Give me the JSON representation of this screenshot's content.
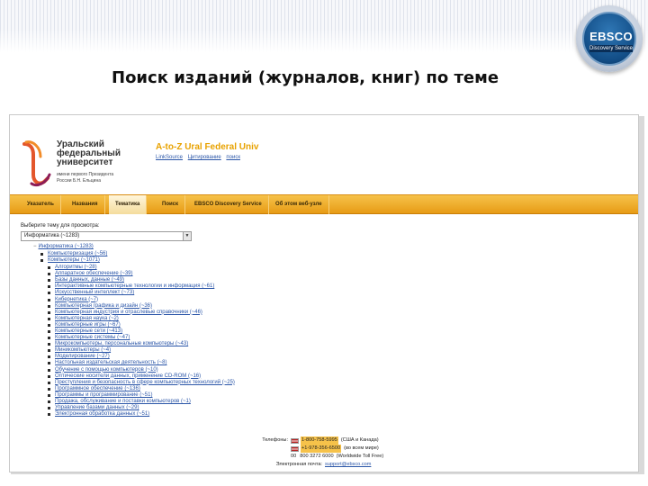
{
  "slide": {
    "title": "Поиск изданий (журналов, книг) по теме",
    "badge": {
      "brand": "EBSCO",
      "tagline": "Discovery Service"
    }
  },
  "site": {
    "university": [
      "Уральский",
      "федеральный",
      "университет"
    ],
    "university_sub": [
      "имени первого Президента",
      "России Б.Н. Ельцина"
    ],
    "az_title": "A-to-Z Ural Federal Univ",
    "az_links": [
      "LinkSource",
      "Цитирование",
      "поиск"
    ]
  },
  "nav": {
    "tabs": [
      "Указатель",
      "Названия",
      "Тематика",
      "Поиск",
      "EBSCO Discovery Service",
      "Об этом веб-узле"
    ],
    "active_index": 2
  },
  "subject_select": {
    "label": "Выберите тему для просмотра:",
    "value": "Информатика (~1283)"
  },
  "tree": {
    "root": "Информатика (~1283)",
    "level1": [
      "Компьютеризация (~56)",
      "Компьютеры (~1071)"
    ],
    "level2": [
      "Алгоритмы (~28)",
      "Аппаратное обеспечение (~39)",
      "Базы данных, данные (~49)",
      "Интерактивные компьютерные технологии и информация (~61)",
      "Искусственный интеллект (~73)",
      "Кибернетика (~7)",
      "Компьютерная графика и дизайн (~36)",
      "Компьютерная индустрия и отраслевые справочники (~46)",
      "Компьютерная наука (~2)",
      "Компьютерные игры (~67)",
      "Компьютерные сети (~413)",
      "Компьютерные системы (~47)",
      "Микрокомпьютеры, персональные компьютеры (~43)",
      "Миникомпьютеры (~4)",
      "Моделирование (~27)",
      "Настольная издательская деятельность (~8)",
      "Обучение с помощью компьютеров (~10)",
      "Оптические носители данных, применение CD-ROM (~16)",
      "Преступления и безопасность в сфере компьютерных технологий (~25)",
      "Программное обеспечение (~136)",
      "Программы и программирование (~51)",
      "Продажа, обслуживание и поставки компьютеров (~1)",
      "Управление базами данных (~29)",
      "Электронная обработка данных (~51)"
    ]
  },
  "contacts": {
    "phone_label": "Телефоны:",
    "phones": [
      {
        "number": "1-800-758-5995",
        "note": "(США и Канада)"
      },
      {
        "number": "+1-978-356-6500",
        "note": "(во всем мире)"
      },
      {
        "prefix": "00",
        "number": "800 3272 6000",
        "note": "(Worldwide Toll Free)"
      }
    ],
    "email_label": "Электронная почта:",
    "email": "support@ebsco.com"
  }
}
